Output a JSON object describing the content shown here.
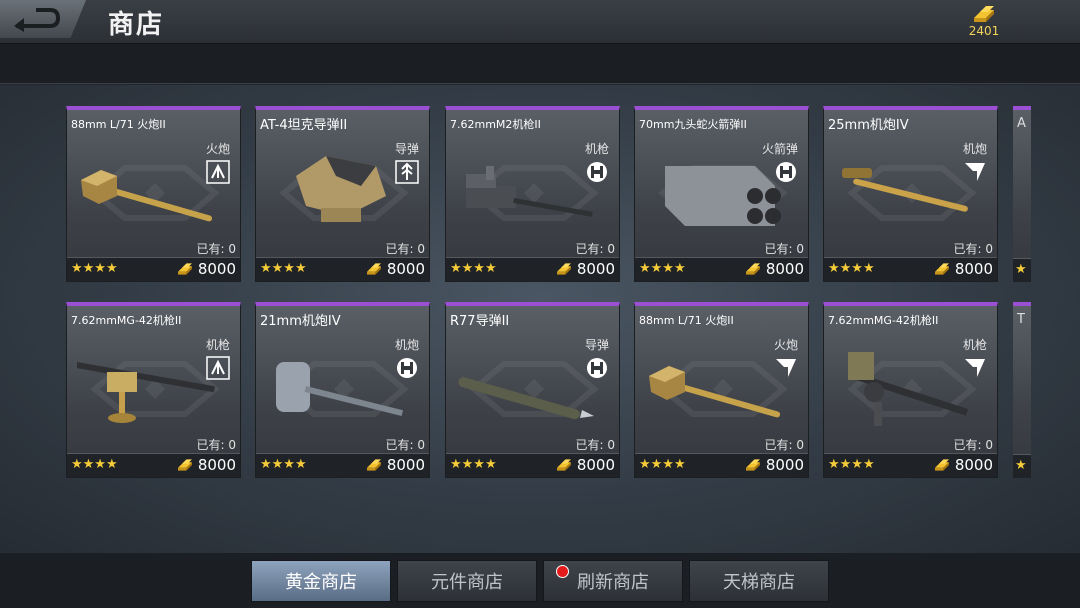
{
  "header": {
    "title": "商店",
    "gold": "2401"
  },
  "colors": {
    "rarity_purple": "#9b4fd3",
    "gold": "#f4cc3a",
    "active_tab": "#7a8ea8"
  },
  "cards": [
    {
      "name": "88mm L/71 火炮II",
      "type": "火炮",
      "icon": "cannon-type-icon",
      "owned": "已有: 0",
      "stars": "★★★★",
      "price": "8000",
      "art": "cannon"
    },
    {
      "name": "AT-4坦克导弹II",
      "type": "导弹",
      "icon": "missile-type-icon",
      "owned": "已有: 0",
      "stars": "★★★★",
      "price": "8000",
      "art": "launcher"
    },
    {
      "name": "7.62mmM2机枪II",
      "type": "机枪",
      "icon": "machinegun-type-icon",
      "owned": "已有: 0",
      "stars": "★★★★",
      "price": "8000",
      "art": "mg"
    },
    {
      "name": "70mm九头蛇火箭弹II",
      "type": "火箭弹",
      "icon": "rocket-type-icon",
      "owned": "已有: 0",
      "stars": "★★★★",
      "price": "8000",
      "art": "pod"
    },
    {
      "name": "25mm机炮IV",
      "type": "机炮",
      "icon": "autocannon-type-icon",
      "owned": "已有: 0",
      "stars": "★★★★",
      "price": "8000",
      "art": "cannon2"
    },
    {
      "name": "7.62mmMG-42机枪II",
      "type": "机枪",
      "icon": "cannon-type-icon",
      "owned": "已有: 0",
      "stars": "★★★★",
      "price": "8000",
      "art": "mg42"
    },
    {
      "name": "21mm机炮IV",
      "type": "机炮",
      "icon": "machinegun-type-icon",
      "owned": "已有: 0",
      "stars": "★★★★",
      "price": "8000",
      "art": "turret"
    },
    {
      "name": "R77导弹II",
      "type": "导弹",
      "icon": "machinegun-type-icon",
      "owned": "已有: 0",
      "stars": "★★★★",
      "price": "8000",
      "art": "missile"
    },
    {
      "name": "88mm L/71 火炮II",
      "type": "火炮",
      "icon": "autocannon-type-icon",
      "owned": "已有: 0",
      "stars": "★★★★",
      "price": "8000",
      "art": "cannon"
    },
    {
      "name": "7.62mmMG-42机枪II",
      "type": "机枪",
      "icon": "autocannon-type-icon",
      "owned": "已有: 0",
      "stars": "★★★★",
      "price": "8000",
      "art": "mg42b"
    }
  ],
  "partial_cards": [
    {
      "letter": "A",
      "stars": "★"
    },
    {
      "letter": "T",
      "stars": "★"
    }
  ],
  "tabs": [
    {
      "label": "黄金商店"
    },
    {
      "label": "元件商店"
    },
    {
      "label": "刷新商店"
    },
    {
      "label": "天梯商店"
    }
  ]
}
